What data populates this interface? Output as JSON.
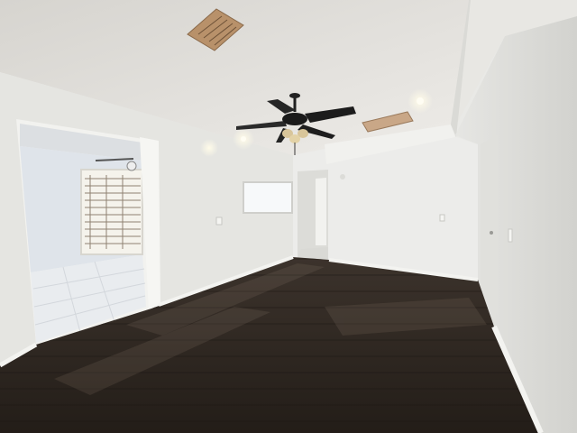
{
  "scene": {
    "description_hidden": "",
    "colors": {
      "ceiling": "#e2e1dd",
      "ceiling_shadow": "#cfcdc8",
      "wall_left": "#e6e6e2",
      "wall_back": "#ebebe8",
      "wall_right": "#dcdcd8",
      "floor_dark": "#2b2520",
      "floor_mid": "#3b322b",
      "floor_light": "#5a4e44",
      "tile": "#e8ebee",
      "baseboard": "#f4f4f1",
      "fan_body": "#1e1e1e",
      "vent": "#b88f6a",
      "window_light": "#f4f1e6",
      "window_blind": "#9a8a78"
    },
    "icons": [
      "ceiling-fan-icon",
      "air-vent-icon",
      "light-fixture-icon",
      "window-icon"
    ]
  }
}
